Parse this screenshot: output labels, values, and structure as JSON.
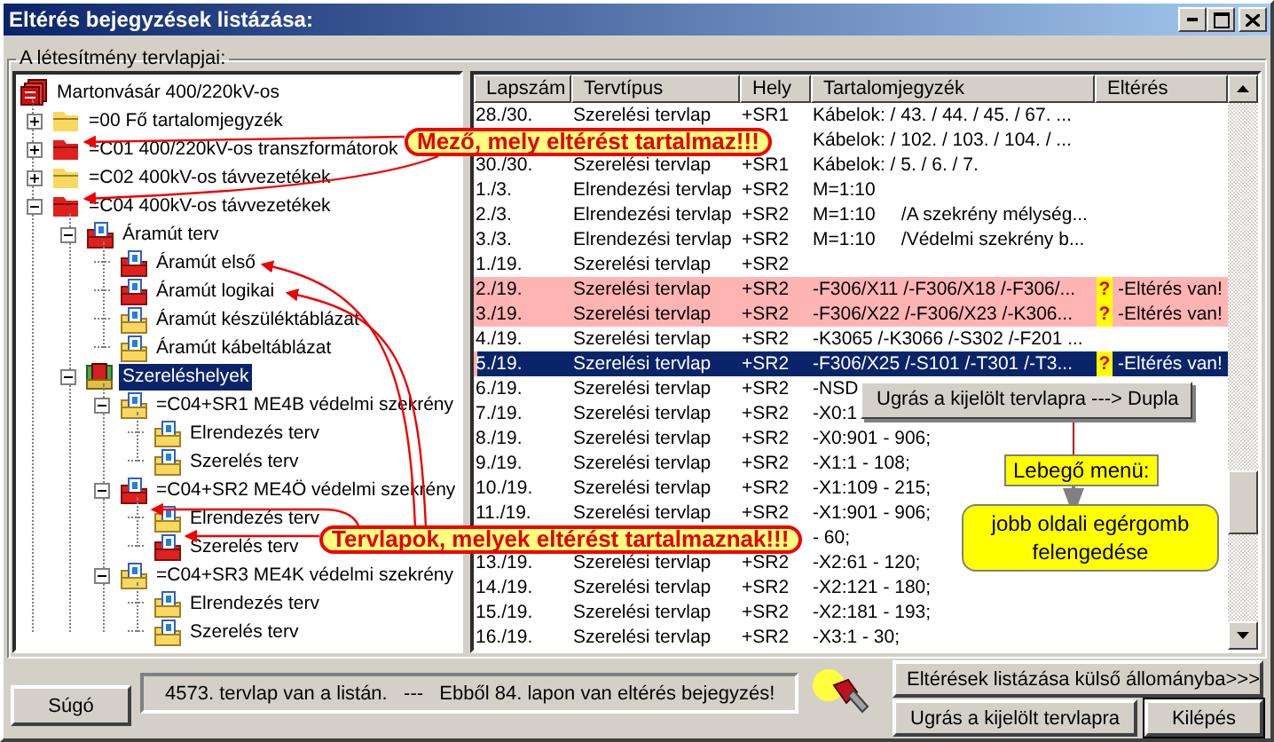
{
  "window": {
    "title": "Eltérés bejegyzések listázása:"
  },
  "group": {
    "title": "A létesítmény tervlapjai:"
  },
  "tree": [
    {
      "label": "Martonvásár 400/220kV-os",
      "kind": "project",
      "deviation": true,
      "selected": false,
      "children": [
        {
          "label": "=00 Fő tartalomjegyzék",
          "kind": "folder",
          "deviation": false,
          "expanded": false,
          "selected": false
        },
        {
          "label": "=C01 400/220kV-os transzformátorok",
          "kind": "folder",
          "deviation": true,
          "expanded": false,
          "selected": false
        },
        {
          "label": "=C02 400kV-os távvezetékek",
          "kind": "folder",
          "deviation": false,
          "expanded": false,
          "selected": false
        },
        {
          "label": "=C04 400kV-os távvezetékek",
          "kind": "folder",
          "deviation": true,
          "expanded": true,
          "selected": false,
          "children": [
            {
              "label": "Áramút terv",
              "kind": "plan",
              "deviation": true,
              "expanded": true,
              "selected": false,
              "children": [
                {
                  "label": "Áramút első",
                  "kind": "plan",
                  "deviation": true,
                  "selected": false
                },
                {
                  "label": "Áramút logikai",
                  "kind": "plan",
                  "deviation": true,
                  "selected": false
                },
                {
                  "label": "Áramút készüléktáblázat",
                  "kind": "plan",
                  "deviation": false,
                  "selected": false
                },
                {
                  "label": "Áramút kábeltáblázat",
                  "kind": "plan",
                  "deviation": false,
                  "selected": false
                }
              ]
            },
            {
              "label": "Szereléshelyek",
              "kind": "places",
              "deviation": true,
              "expanded": true,
              "selected": true,
              "children": [
                {
                  "label": "=C04+SR1 ME4B védelmi szekrény",
                  "kind": "plan",
                  "deviation": false,
                  "expanded": true,
                  "selected": false,
                  "children": [
                    {
                      "label": "Elrendezés terv",
                      "kind": "plan",
                      "deviation": false,
                      "selected": false
                    },
                    {
                      "label": "Szerelés terv",
                      "kind": "plan",
                      "deviation": false,
                      "selected": false
                    }
                  ]
                },
                {
                  "label": "=C04+SR2 ME4Ö védelmi szekrény",
                  "kind": "plan",
                  "deviation": true,
                  "expanded": true,
                  "selected": false,
                  "children": [
                    {
                      "label": "Elrendezés terv",
                      "kind": "plan",
                      "deviation": false,
                      "selected": false
                    },
                    {
                      "label": "Szerelés terv",
                      "kind": "plan",
                      "deviation": true,
                      "selected": false
                    }
                  ]
                },
                {
                  "label": "=C04+SR3 ME4K védelmi szekrény",
                  "kind": "plan",
                  "deviation": false,
                  "expanded": true,
                  "selected": false,
                  "children": [
                    {
                      "label": "Elrendezés terv",
                      "kind": "plan",
                      "deviation": false,
                      "selected": false
                    },
                    {
                      "label": "Szerelés terv",
                      "kind": "plan",
                      "deviation": false,
                      "selected": false
                    }
                  ]
                }
              ]
            }
          ]
        }
      ]
    }
  ],
  "table": {
    "columns": [
      "Lapszám",
      "Tervtípus",
      "Hely",
      "Tartalomjegyzék",
      "Eltérés"
    ],
    "rows": [
      {
        "page": "28./30.",
        "type": "Szerelési tervlap",
        "location": "+SR1",
        "contents": "Kábelok: / 43. / 44. / 45. / 67. ...",
        "selected": false,
        "flagged": false
      },
      {
        "contents": "Kábelok: / 102. / 103. / 104. / ...",
        "selected": false,
        "flagged": false
      },
      {
        "page": "30./30.",
        "type": "Szerelési tervlap",
        "location": "+SR1",
        "contents": "Kábelok: / 5. / 6. / 7.",
        "selected": false,
        "flagged": false
      },
      {
        "page": "1./3.",
        "type": "Elrendezési tervlap",
        "location": "+SR2",
        "contents": "M=1:10",
        "selected": false,
        "flagged": false
      },
      {
        "page": "2./3.",
        "type": "Elrendezési tervlap",
        "location": "+SR2",
        "contents": "M=1:10     /A szekrény mélység...",
        "selected": false,
        "flagged": false
      },
      {
        "page": "3./3.",
        "type": "Elrendezési tervlap",
        "location": "+SR2",
        "contents": "M=1:10     /Védelmi szekrény b...",
        "selected": false,
        "flagged": false
      },
      {
        "page": "1./19.",
        "type": "Szerelési tervlap",
        "location": "+SR2",
        "selected": false,
        "flagged": false
      },
      {
        "page": "2./19.",
        "type": "Szerelési tervlap",
        "location": "+SR2",
        "contents": "-F306/X11 /-F306/X18 /-F306/...",
        "mark": "?",
        "note": "-Eltérés van!",
        "selected": false,
        "flagged": true
      },
      {
        "page": "3./19.",
        "type": "Szerelési tervlap",
        "location": "+SR2",
        "contents": "-F306/X22 /-F306/X23 /-K306...",
        "mark": "?",
        "note": "-Eltérés van!",
        "selected": false,
        "flagged": true
      },
      {
        "page": "4./19.",
        "type": "Szerelési tervlap",
        "location": "+SR2",
        "contents": "-K3065 /-K3066 /-S302 /-F201 ...",
        "selected": false,
        "flagged": false
      },
      {
        "page": "5./19.",
        "type": "Szerelési tervlap",
        "location": "+SR2",
        "contents": "-F306/X25 /-S101 /-T301 /-T3...",
        "mark": "?",
        "note": "-Eltérés van!",
        "selected": true,
        "flagged": true
      },
      {
        "page": "6./19.",
        "type": "Szerelési tervlap",
        "location": "+SR2",
        "contents": "-NSD",
        "selected": false,
        "flagged": false
      },
      {
        "page": "7./19.",
        "type": "Szerelési tervlap",
        "location": "+SR2",
        "contents": "-X0:1",
        "selected": false,
        "flagged": false
      },
      {
        "page": "8./19.",
        "type": "Szerelési tervlap",
        "location": "+SR2",
        "contents": "-X0:901 - 906;",
        "selected": false,
        "flagged": false
      },
      {
        "page": "9./19.",
        "type": "Szerelési tervlap",
        "location": "+SR2",
        "contents": "-X1:1 - 108;",
        "selected": false,
        "flagged": false
      },
      {
        "page": "10./19.",
        "type": "Szerelési tervlap",
        "location": "+SR2",
        "contents": "-X1:109 - 215;",
        "selected": false,
        "flagged": false
      },
      {
        "page": "11./19.",
        "type": "Szerelési tervlap",
        "location": "+SR2",
        "contents": "-X1:901 - 906;",
        "selected": false,
        "flagged": false
      },
      {
        "contents": "- 60;",
        "selected": false,
        "flagged": false
      },
      {
        "page": "13./19.",
        "type": "Szerelési tervlap",
        "location": "+SR2",
        "contents": "-X2:61 - 120;",
        "selected": false,
        "flagged": false
      },
      {
        "page": "14./19.",
        "type": "Szerelési tervlap",
        "location": "+SR2",
        "contents": "-X2:121 - 180;",
        "selected": false,
        "flagged": false
      },
      {
        "page": "15./19.",
        "type": "Szerelési tervlap",
        "location": "+SR2",
        "contents": "-X2:181 - 193;",
        "selected": false,
        "flagged": false
      },
      {
        "page": "16./19.",
        "type": "Szerelési tervlap",
        "location": "+SR2",
        "contents": "-X3:1 - 30;",
        "selected": false,
        "flagged": false
      }
    ]
  },
  "status": "4573. tervlap van a listán.   ---   Ebből 84. lapon van eltérés bejegyzés!",
  "buttons": [
    {
      "label": "Súgó",
      "kind": "help",
      "default": false
    },
    {
      "label": "Eltérések listázása külső állományba>>>",
      "kind": "export",
      "default": false
    },
    {
      "label": "Ugrás a kijelölt tervlapra",
      "kind": "jump",
      "default": false
    },
    {
      "label": "Kilépés",
      "kind": "exit",
      "default": true
    }
  ],
  "annotations": {
    "callouts": [
      "Mező, mely eltérést tartalmaz!!!",
      "Tervlapok, melyek eltérést tartalmaznak!!!"
    ],
    "popup_menu": [
      "Ugrás a kijelölt tervlapra ---> Dupla"
    ],
    "hint_label": "Lebegő menü:",
    "hint_text": "jobb oldali egérgomb felengedése"
  }
}
